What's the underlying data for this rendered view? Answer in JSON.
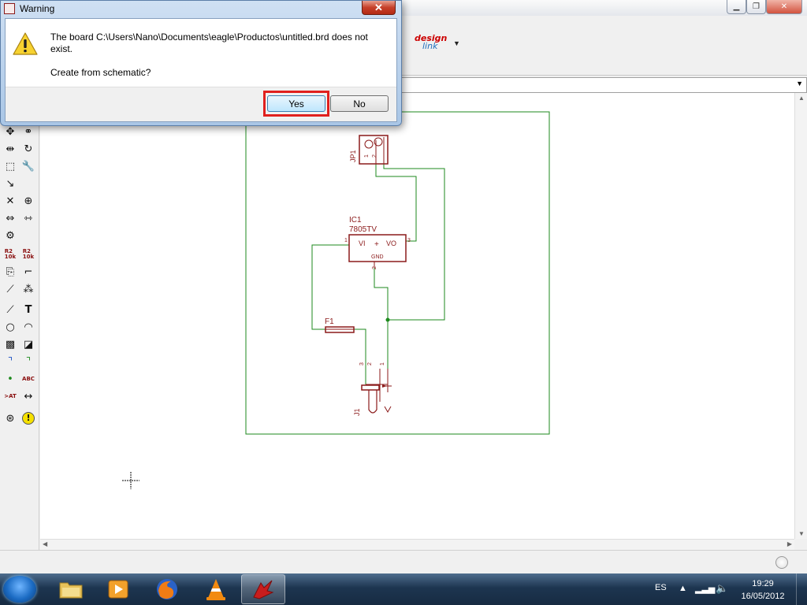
{
  "app": {
    "toolbar_brand": {
      "a": "design",
      "b": "link"
    },
    "palette_labels": {
      "resistor_value": "R2\n10k",
      "smash_text": ">AT",
      "name_text": "ABC",
      "errors": "!"
    }
  },
  "dialog": {
    "title": "Warning",
    "message_line": "The board C:\\Users\\Nano\\Documents\\eagle\\Productos\\untitled.brd does not exist.",
    "question": "Create from schematic?",
    "yes_label": "Yes",
    "no_label": "No",
    "close_glyph": "✕"
  },
  "schematic": {
    "jp1_name": "JP1",
    "ic1_name": "IC1",
    "ic1_value": "7805TV",
    "ic1_pin_vi": "VI",
    "ic1_pin_vo": "VO",
    "ic1_pin_gnd": "GND",
    "ic1_pin1": "1",
    "ic1_pin2": "2",
    "ic1_pin3": "3",
    "f1_name": "F1",
    "j1_name": "J1",
    "j1_pins": [
      "3",
      "2",
      "1"
    ],
    "jp1_pins": [
      "1",
      "2"
    ],
    "colors": {
      "wire": "#1e8a1e",
      "part": "#8b1a1a",
      "frame": "#1e8a1e"
    }
  },
  "taskbar": {
    "language": "ES",
    "time": "19:29",
    "date": "16/05/2012"
  }
}
